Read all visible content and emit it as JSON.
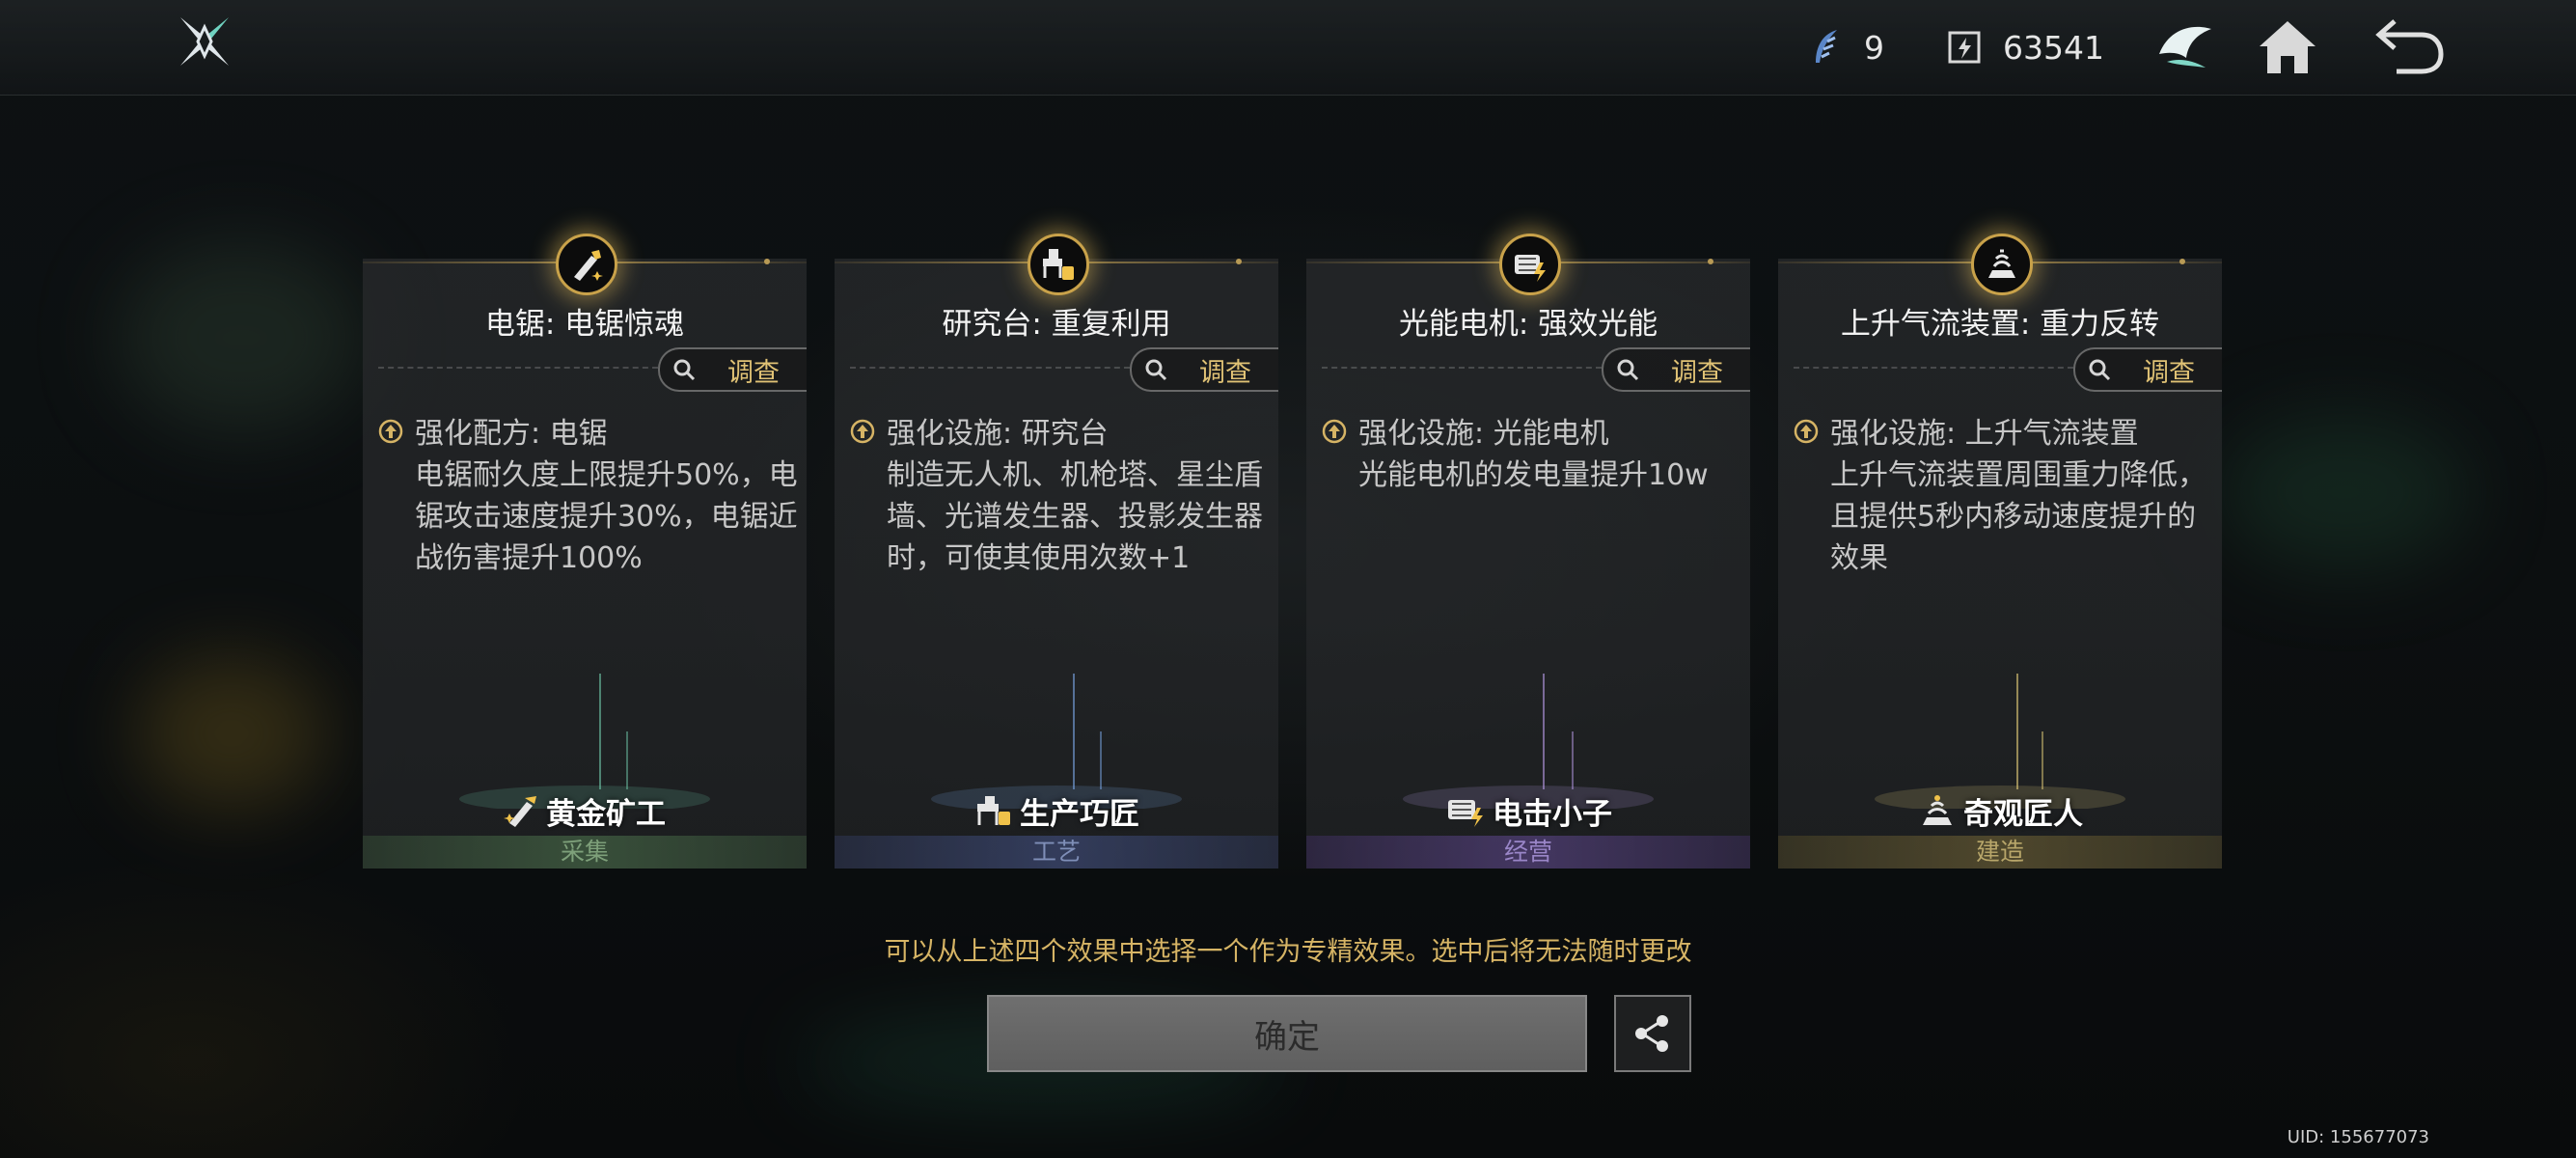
{
  "topbar": {
    "currency1_value": "9",
    "currency2_value": "63541",
    "icons": [
      "logo-icon",
      "feather-currency-icon",
      "energy-currency-icon",
      "wing-emblem-icon",
      "home-icon",
      "back-icon"
    ]
  },
  "cards": [
    {
      "title": "电锯: 电锯惊魂",
      "investigate": "调查",
      "head": "强化配方: 电锯",
      "body": "电锯耐久度上限提升50%，电锯攻击速度提升30%，电锯近战伤害提升100%",
      "role": "黄金矿工",
      "category": "采集",
      "color": "#7ea07a",
      "line_color": "#6fc6a8"
    },
    {
      "title": "研究台: 重复利用",
      "investigate": "调查",
      "head": "强化设施: 研究台",
      "body": "制造无人机、机枪塔、星尘盾墙、光谱发生器、投影发生器时，可使其使用次数+1",
      "role": "生产巧匠",
      "category": "工艺",
      "color": "#7f8fb8",
      "line_color": "#7aa6e6"
    },
    {
      "title": "光能电机: 强效光能",
      "investigate": "调查",
      "head": "强化设施: 光能电机",
      "body": "光能电机的发电量提升10w",
      "role": "电击小子",
      "category": "经营",
      "color": "#9a86c8",
      "line_color": "#b79ae6"
    },
    {
      "title": "上升气流装置: 重力反转",
      "investigate": "调查",
      "head": "强化设施: 上升气流装置",
      "body": "上升气流装置周围重力降低，且提供5秒内移动速度提升的效果",
      "role": "奇观匠人",
      "category": "建造",
      "color": "#b8a66a",
      "line_color": "#e6cf7a"
    }
  ],
  "hint": "可以从上述四个效果中选择一个作为专精效果。选中后将无法随时更改",
  "confirm_label": "确定",
  "uid": "UID: 155677073"
}
